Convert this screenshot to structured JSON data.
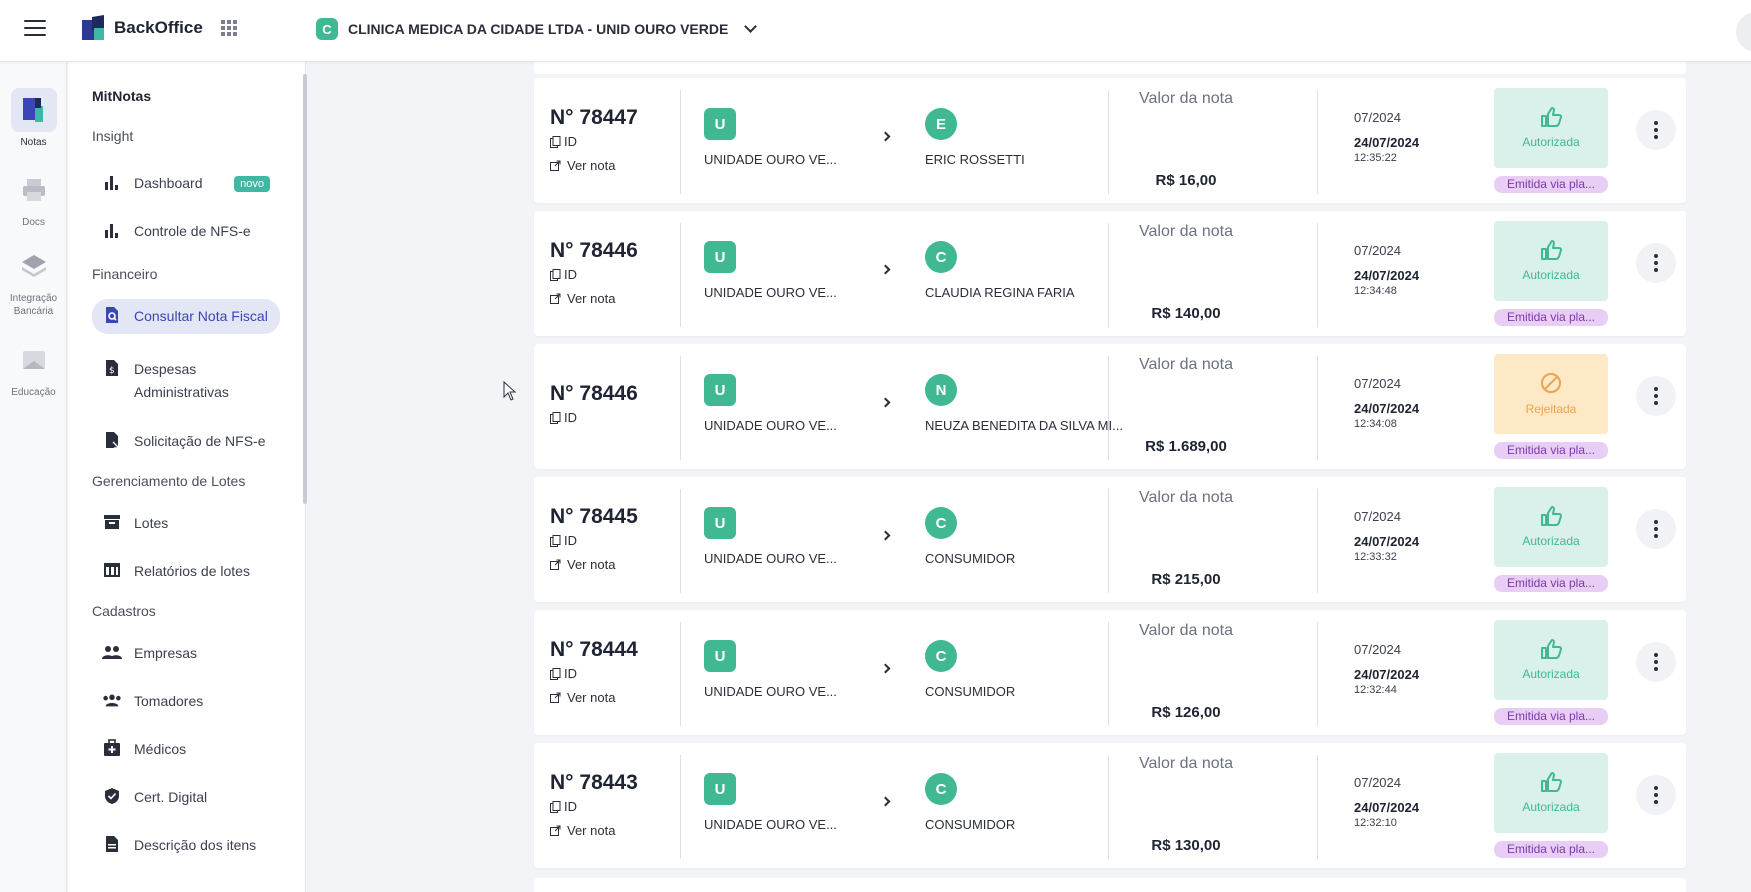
{
  "header": {
    "brand": "BackOffice",
    "company_initial": "C",
    "company_name": "CLINICA MEDICA DA CIDADE LTDA - UNID OURO VERDE"
  },
  "rail": [
    {
      "label": "Notas",
      "icon": "notes-icon",
      "active": true
    },
    {
      "label": "Docs",
      "icon": "printer-icon",
      "active": false
    },
    {
      "label": "Integração Bancária",
      "icon": "layers-icon",
      "active": false
    },
    {
      "label": "Educação",
      "icon": "education-icon",
      "active": false
    }
  ],
  "menu": {
    "title": "MitNotas",
    "sections": {
      "insight": "Insight",
      "financeiro": "Financeiro",
      "lotes": "Gerenciamento de Lotes",
      "cadastros": "Cadastros"
    },
    "items": {
      "dashboard": "Dashboard",
      "dashboard_badge": "novo",
      "controle": "Controle de NFS-e",
      "consultar": "Consultar Nota Fiscal",
      "despesas": "Despesas Administrativas",
      "solicitacao": "Solicitação de NFS-e",
      "lotes": "Lotes",
      "relatorios": "Relatórios de lotes",
      "empresas": "Empresas",
      "tomadores": "Tomadores",
      "medicos": "Médicos",
      "cert": "Cert. Digital",
      "descricao": "Descrição dos itens"
    }
  },
  "notes_common": {
    "id_label": "ID",
    "ver_nota": "Ver nota",
    "valor_label": "Valor da nota",
    "tag": "Emitida via pla...",
    "issuer_initial": "U",
    "issuer_name": "UNIDADE OURO VE..."
  },
  "notes": [
    {
      "number": "N° 78447",
      "recipient_initial": "E",
      "recipient": "ERIC ROSSETTI",
      "amount": "R$ 16,00",
      "month": "07/2024",
      "date": "24/07/2024",
      "time": "12:35:22",
      "status": "Autorizada",
      "has_link": true
    },
    {
      "number": "N° 78446",
      "recipient_initial": "C",
      "recipient": "CLAUDIA REGINA FARIA",
      "amount": "R$ 140,00",
      "month": "07/2024",
      "date": "24/07/2024",
      "time": "12:34:48",
      "status": "Autorizada",
      "has_link": true
    },
    {
      "number": "N° 78446",
      "recipient_initial": "N",
      "recipient": "NEUZA BENEDITA DA SILVA MI...",
      "amount": "R$ 1.689,00",
      "month": "07/2024",
      "date": "24/07/2024",
      "time": "12:34:08",
      "status": "Rejeitada",
      "has_link": false
    },
    {
      "number": "N° 78445",
      "recipient_initial": "C",
      "recipient": "CONSUMIDOR",
      "amount": "R$ 215,00",
      "month": "07/2024",
      "date": "24/07/2024",
      "time": "12:33:32",
      "status": "Autorizada",
      "has_link": true
    },
    {
      "number": "N° 78444",
      "recipient_initial": "C",
      "recipient": "CONSUMIDOR",
      "amount": "R$ 126,00",
      "month": "07/2024",
      "date": "24/07/2024",
      "time": "12:32:44",
      "status": "Autorizada",
      "has_link": true
    },
    {
      "number": "N° 78443",
      "recipient_initial": "C",
      "recipient": "CONSUMIDOR",
      "amount": "R$ 130,00",
      "month": "07/2024",
      "date": "24/07/2024",
      "time": "12:32:10",
      "status": "Autorizada",
      "has_link": true
    }
  ],
  "colors": {
    "accent": "#3a45b6",
    "avatar": "#3fb893",
    "authorized_bg": "#d9f1ea",
    "rejected_bg": "#fde9c6",
    "tag_bg": "#e8cdf4"
  }
}
